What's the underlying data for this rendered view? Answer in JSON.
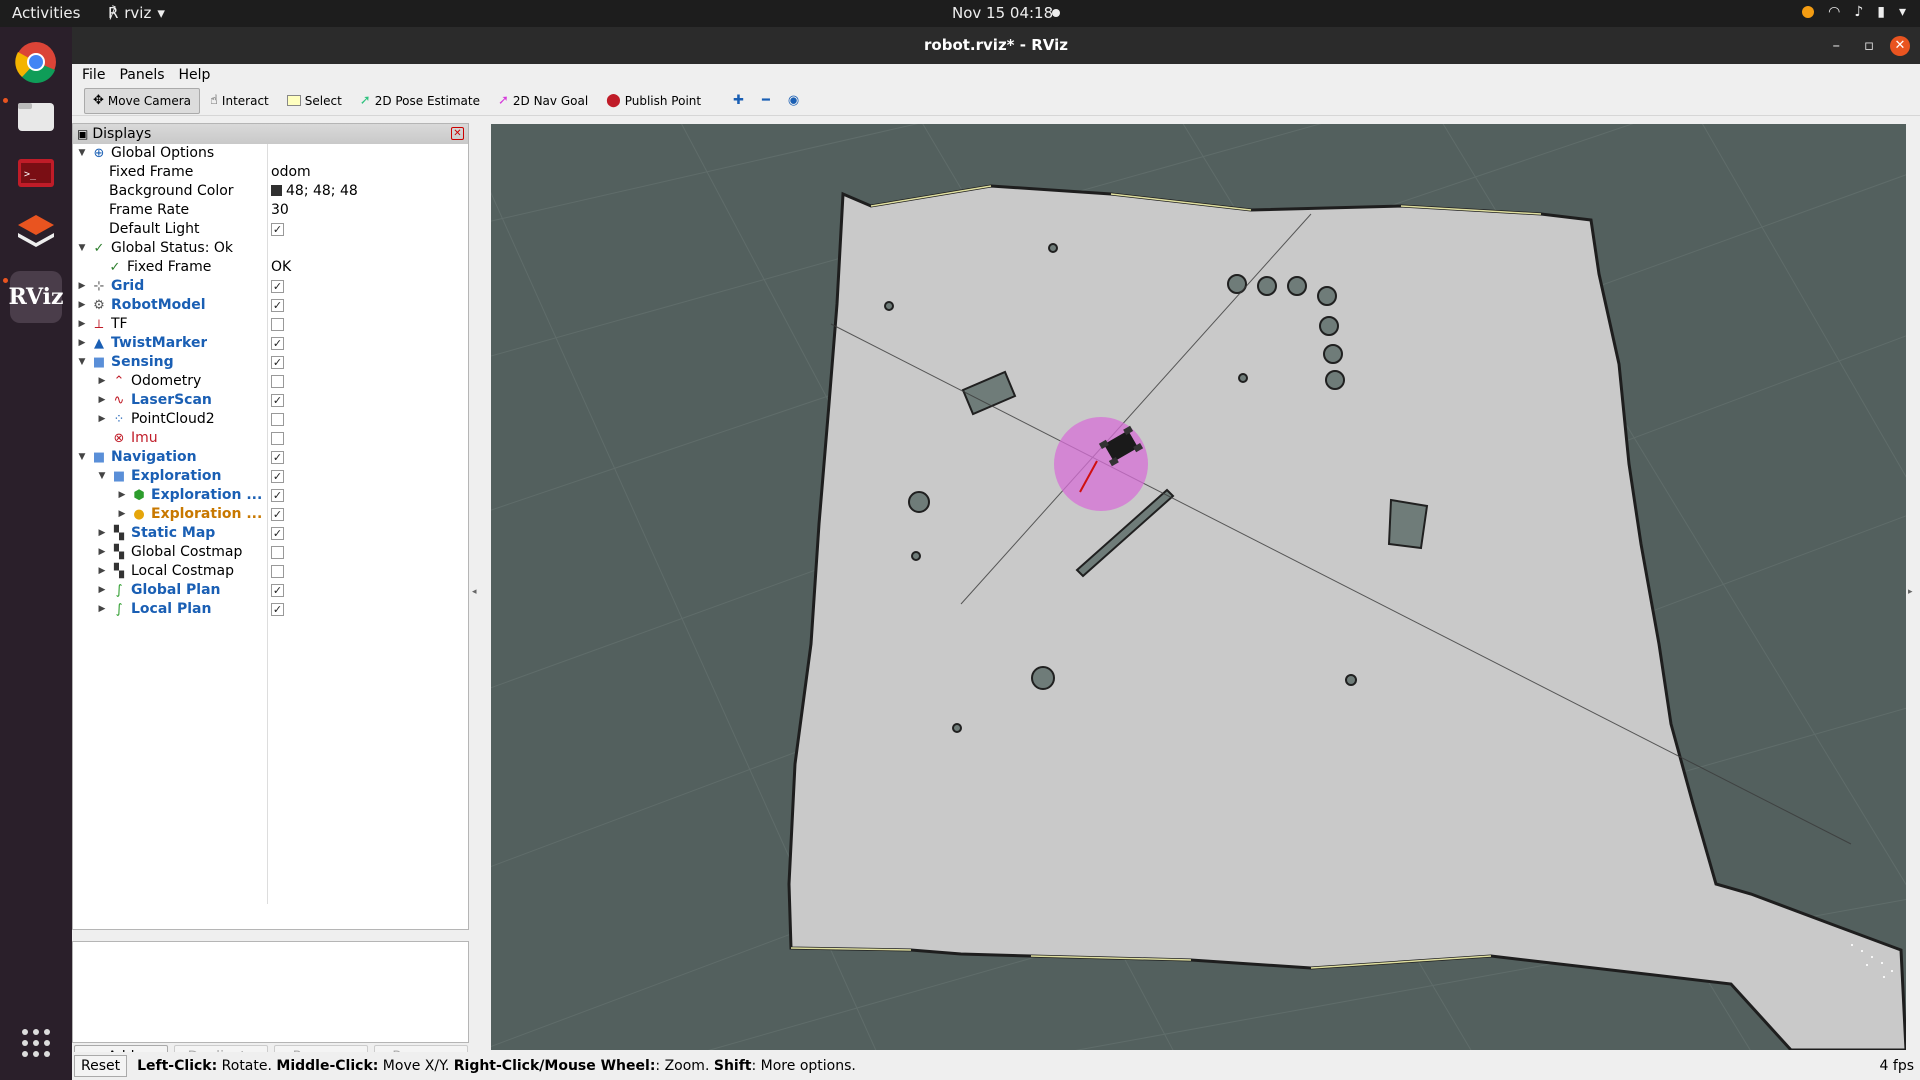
{
  "topbar": {
    "activities": "Activities",
    "app_name": "rviz",
    "clock": "Nov 15  04:18"
  },
  "window": {
    "title": "robot.rviz* - RViz"
  },
  "menu": {
    "file": "File",
    "panels": "Panels",
    "help": "Help"
  },
  "toolbar": {
    "move_camera": "Move Camera",
    "interact": "Interact",
    "select": "Select",
    "pose_estimate": "2D Pose Estimate",
    "nav_goal": "2D Nav Goal",
    "publish_point": "Publish Point"
  },
  "displays": {
    "title": "Displays",
    "global_options": "Global Options",
    "fixed_frame_label": "Fixed Frame",
    "fixed_frame_value": "odom",
    "bg_color_label": "Background Color",
    "bg_color_value": "48; 48; 48",
    "frame_rate_label": "Frame Rate",
    "frame_rate_value": "30",
    "default_light_label": "Default Light",
    "global_status": "Global Status: Ok",
    "status_fixed_frame": "Fixed Frame",
    "status_fixed_frame_value": "OK",
    "grid": "Grid",
    "robot_model": "RobotModel",
    "tf": "TF",
    "twist_marker": "TwistMarker",
    "sensing": "Sensing",
    "odometry": "Odometry",
    "laser_scan": "LaserScan",
    "point_cloud": "PointCloud2",
    "imu": "Imu",
    "navigation": "Navigation",
    "exploration": "Exploration",
    "exploration_1": "Exploration ...",
    "exploration_2": "Exploration ...",
    "static_map": "Static Map",
    "global_costmap": "Global Costmap",
    "local_costmap": "Local Costmap",
    "global_plan": "Global Plan",
    "local_plan": "Local Plan"
  },
  "buttons": {
    "add": "Add",
    "duplicate": "Duplicate",
    "remove": "Remove",
    "rename": "Rename"
  },
  "status": {
    "reset": "Reset",
    "lc": "Left-Click:",
    "lc_t": " Rotate. ",
    "mc": "Middle-Click:",
    "mc_t": " Move X/Y. ",
    "rc": "Right-Click/Mouse Wheel:",
    "rc_t": ": Zoom. ",
    "sh": "Shift",
    "sh_t": ": More options.",
    "fps": "4 fps"
  },
  "colors": {
    "background": "#303030",
    "map_free": "#c8c8c8",
    "footprint": "#d66fd6",
    "accent": "#e95420"
  }
}
